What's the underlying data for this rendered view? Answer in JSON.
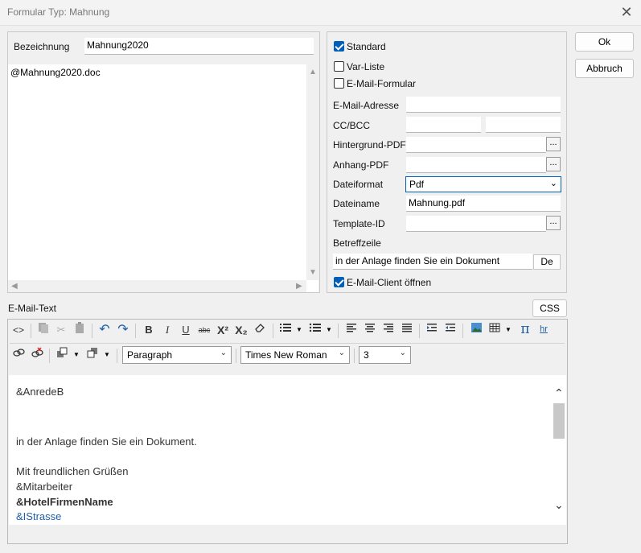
{
  "window": {
    "title": "Formular Typ: Mahnung"
  },
  "left": {
    "bezeichnung_label": "Bezeichnung",
    "bezeichnung_value": "Mahnung2020",
    "doc_text": "@Mahnung2020.doc"
  },
  "right": {
    "standard_label": "Standard",
    "varliste_label": "Var-Liste",
    "emailformular_label": "E-Mail-Formular",
    "email_adresse_label": "E-Mail-Adresse",
    "email_adresse_value": "",
    "ccbcc_label": "CC/BCC",
    "cc_value": "",
    "bcc_value": "",
    "hintergrund_label": "Hintergrund-PDF",
    "hintergrund_value": "",
    "anhang_label": "Anhang-PDF",
    "anhang_value": "",
    "dateiformat_label": "Dateiformat",
    "dateiformat_value": "Pdf",
    "dateiname_label": "Dateiname",
    "dateiname_value": "Mahnung.pdf",
    "template_label": "Template-ID",
    "template_value": "",
    "betreff_label": "Betreffzeile",
    "betreff_value": "in der Anlage finden Sie ein Dokument",
    "lang_button": "De",
    "emailclient_label": "E-Mail-Client öffnen",
    "browse": "..."
  },
  "buttons": {
    "ok": "Ok",
    "cancel": "Abbruch",
    "css": "CSS"
  },
  "emailtext": {
    "label": "E-Mail-Text",
    "format_select": "Paragraph",
    "font_select": "Times New Roman",
    "size_select": "3",
    "lines": {
      "l1": "&AnredeB",
      "l2": "in der Anlage finden Sie ein Dokument.",
      "l3": "Mit freundlichen Grüßen",
      "l4": "&Mitarbeiter",
      "l5": "&HotelFirmenName",
      "l6": "&IStrasse"
    }
  },
  "icons": {
    "source": "<>",
    "bold": "B",
    "italic": "I",
    "underline": "U",
    "strike": "abc",
    "superscript": "X²",
    "subscript": "X₂",
    "pi": "π",
    "hr": "hr"
  },
  "colors": {
    "accent": "#005fb8",
    "link": "#1f5fa8"
  }
}
